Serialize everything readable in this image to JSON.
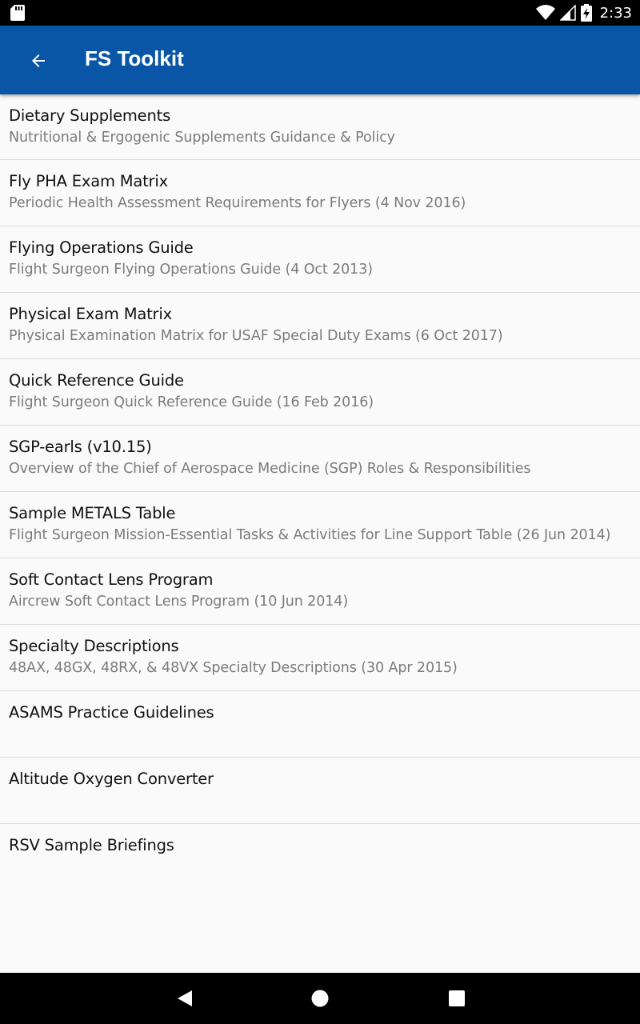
{
  "status_bar": {
    "time": "2:33",
    "icons": [
      "sd-card-icon",
      "wifi-icon",
      "cell-signal-icon",
      "battery-charging-icon"
    ]
  },
  "app_bar": {
    "title": "FS Toolkit",
    "back_icon": "arrow-back-icon"
  },
  "items": [
    {
      "title": "Dietary Supplements",
      "subtitle": "Nutritional & Ergogenic Supplements Guidance & Policy"
    },
    {
      "title": "Fly PHA Exam Matrix",
      "subtitle": "Periodic Health Assessment Requirements for Flyers (4 Nov 2016)"
    },
    {
      "title": "Flying Operations Guide",
      "subtitle": "Flight Surgeon Flying Operations Guide (4 Oct 2013)"
    },
    {
      "title": "Physical Exam Matrix",
      "subtitle": "Physical Examination Matrix for USAF Special Duty Exams (6 Oct 2017)"
    },
    {
      "title": "Quick Reference Guide",
      "subtitle": "Flight Surgeon Quick Reference Guide (16 Feb 2016)"
    },
    {
      "title": "SGP-earls (v10.15)",
      "subtitle": "Overview of the Chief of Aerospace Medicine (SGP) Roles & Responsibilities"
    },
    {
      "title": "Sample METALS Table",
      "subtitle": "Flight Surgeon Mission-Essential Tasks & Activities for Line Support Table (26 Jun 2014)"
    },
    {
      "title": "Soft Contact Lens Program",
      "subtitle": "Aircrew Soft Contact Lens Program (10 Jun 2014)"
    },
    {
      "title": "Specialty Descriptions",
      "subtitle": "48AX, 48GX, 48RX, & 48VX Specialty Descriptions (30 Apr 2015)"
    },
    {
      "title": "ASAMS Practice Guidelines",
      "subtitle": ""
    },
    {
      "title": "Altitude Oxygen Converter",
      "subtitle": ""
    },
    {
      "title": "RSV Sample Briefings",
      "subtitle": ""
    }
  ],
  "nav_bar": {
    "icons": [
      "back-triangle-icon",
      "home-circle-icon",
      "recents-square-icon"
    ]
  },
  "colors": {
    "app_bar": "#0a56a6",
    "status_bar": "#000000",
    "background": "#fafafa",
    "title_text": "#111111",
    "subtitle_text": "#7b7b7b",
    "divider": "#dcdcdc"
  }
}
